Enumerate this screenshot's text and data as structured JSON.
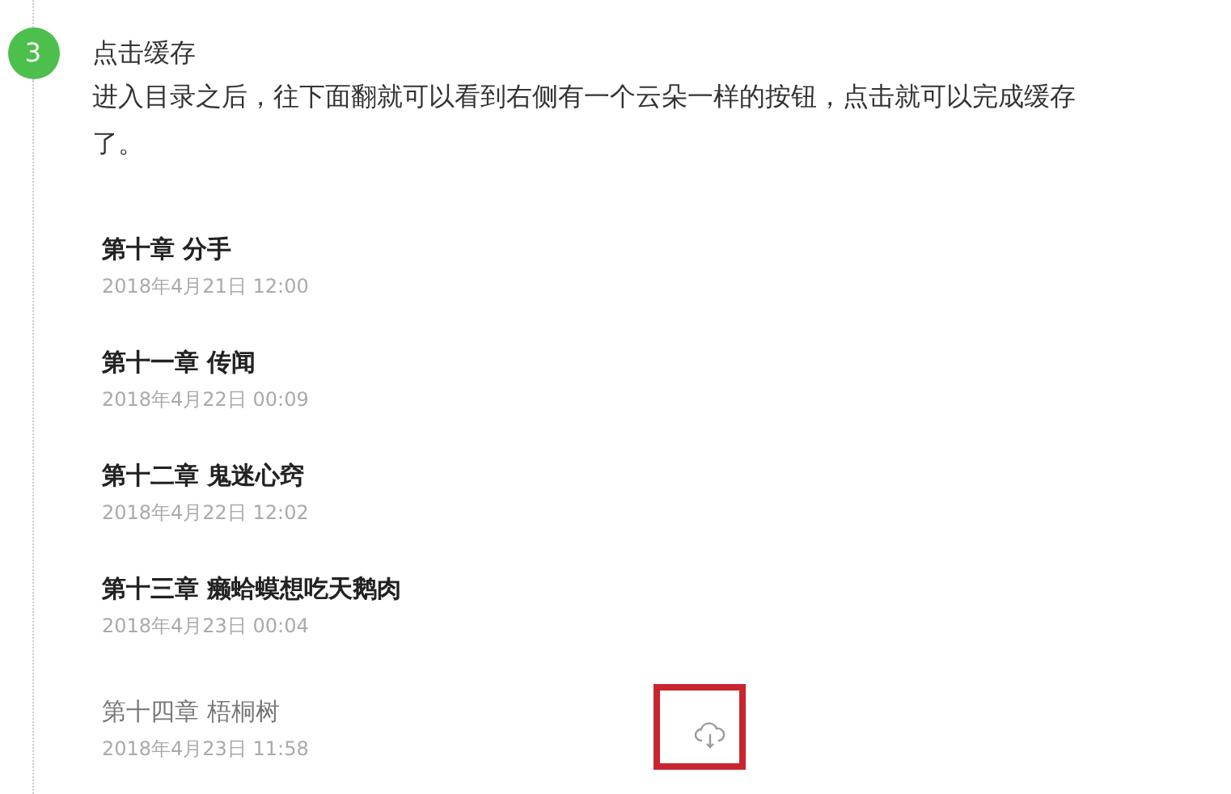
{
  "step": {
    "number": "3",
    "title": "点击缓存",
    "text": "进入目录之后，往下面翻就可以看到右侧有一个云朵一样的按钮，点击就可以完成缓存了。"
  },
  "chapters": [
    {
      "name": "第十章 分手",
      "date": "2018年4月21日 12:00",
      "read": false
    },
    {
      "name": "第十一章 传闻",
      "date": "2018年4月22日 00:09",
      "read": false
    },
    {
      "name": "第十二章 鬼迷心窍",
      "date": "2018年4月22日 12:02",
      "read": false
    },
    {
      "name": "第十三章 癞蛤蟆想吃天鹅肉",
      "date": "2018年4月23日 00:04",
      "read": false
    },
    {
      "name": "第十四章 梧桐树",
      "date": "2018年4月23日 11:58",
      "read": true,
      "cloud_button": {
        "highlighted": true
      }
    }
  ]
}
